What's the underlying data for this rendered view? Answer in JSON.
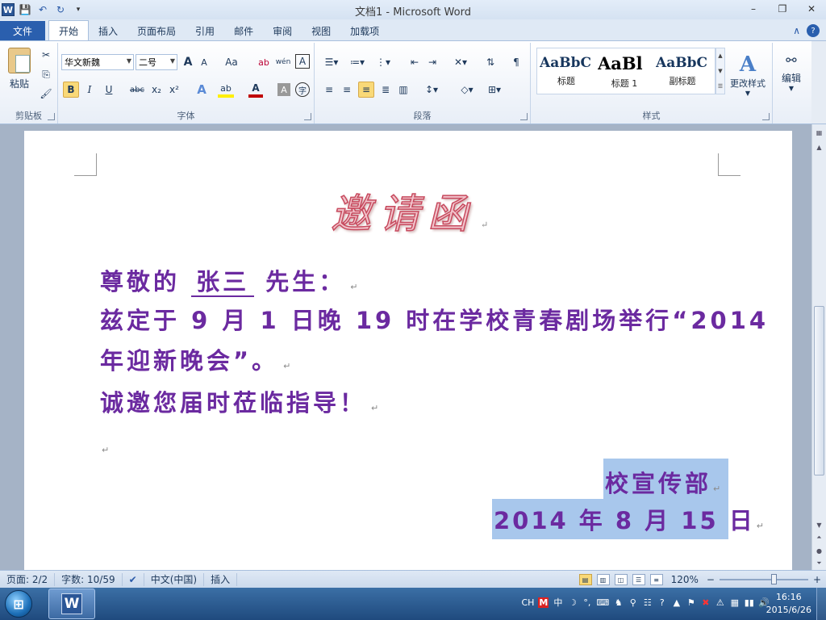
{
  "window": {
    "title": "文档1 - Microsoft Word",
    "minimize": "–",
    "restore": "❐",
    "close": "✕"
  },
  "qat": {
    "app_icon": "W",
    "save": "💾",
    "undo": "↶",
    "redo": "↻",
    "customize": "▾"
  },
  "tabs": [
    {
      "label": "文件"
    },
    {
      "label": "开始"
    },
    {
      "label": "插入"
    },
    {
      "label": "页面布局"
    },
    {
      "label": "引用"
    },
    {
      "label": "邮件"
    },
    {
      "label": "审阅"
    },
    {
      "label": "视图"
    },
    {
      "label": "加载项"
    }
  ],
  "tab_icons": {
    "collapse": "∧",
    "help": "?"
  },
  "ribbon": {
    "clipboard": {
      "label": "剪贴板",
      "paste": "粘贴"
    },
    "font": {
      "label": "字体",
      "font_name": "华文新魏",
      "font_size": "二号",
      "grow": "A",
      "shrink": "A",
      "case": "Aa",
      "clear": "ab",
      "phonetic": "wén",
      "border": "A",
      "bold": "B",
      "italic": "I",
      "underline": "U",
      "strike": "abc",
      "subscript": "x₂",
      "superscript": "x²",
      "effects": "A",
      "highlight": "ab",
      "color": "A",
      "shade": "A",
      "enclose": "字"
    },
    "paragraph": {
      "label": "段落"
    },
    "styles": {
      "label": "样式",
      "tiles": [
        {
          "sample": "AaBbC",
          "name": "标题"
        },
        {
          "sample": "AaBl",
          "name": "标题 1"
        },
        {
          "sample": "AaBbC",
          "name": "副标题"
        }
      ],
      "change_styles": "更改样式"
    },
    "editing": {
      "label": "编辑"
    }
  },
  "document": {
    "title": "邀请函",
    "greeting_pre": "尊敬的",
    "name": "张三",
    "greeting_post": "先生：",
    "body_line1": "兹定于 9 月 1 日晚 19 时在学校青春剧场举行“2014",
    "body_line2": "年迎新晚会”。",
    "body_line3": "诚邀您届时莅临指导！",
    "sign_dept": "校宣传部",
    "sign_date": "2014 年 8 月 15 日",
    "para_mark": "↵"
  },
  "status": {
    "page": "页面: 2/2",
    "words": "字数: 10/59",
    "language": "中文(中国)",
    "mode": "插入",
    "zoom": "120%",
    "zoom_out": "−",
    "zoom_in": "+"
  },
  "taskbar": {
    "start_icon": "windows-logo",
    "app": "W",
    "tray": [
      "CH",
      "M",
      "中",
      "☽",
      "°,",
      "⌨",
      "♞",
      "⚲",
      "☷",
      "?",
      "▲",
      "⚑",
      "✖",
      "⚠",
      "▦",
      "▮▮",
      "🔊"
    ],
    "time": "16:16",
    "date": "2015/6/26"
  },
  "colors": {
    "doc_text": "#6b2aa0",
    "title_fill": "#f2c4cc",
    "title_stroke": "#c74a5e",
    "selection": "#a8c7ec",
    "file_tab": "#2a5fae"
  }
}
